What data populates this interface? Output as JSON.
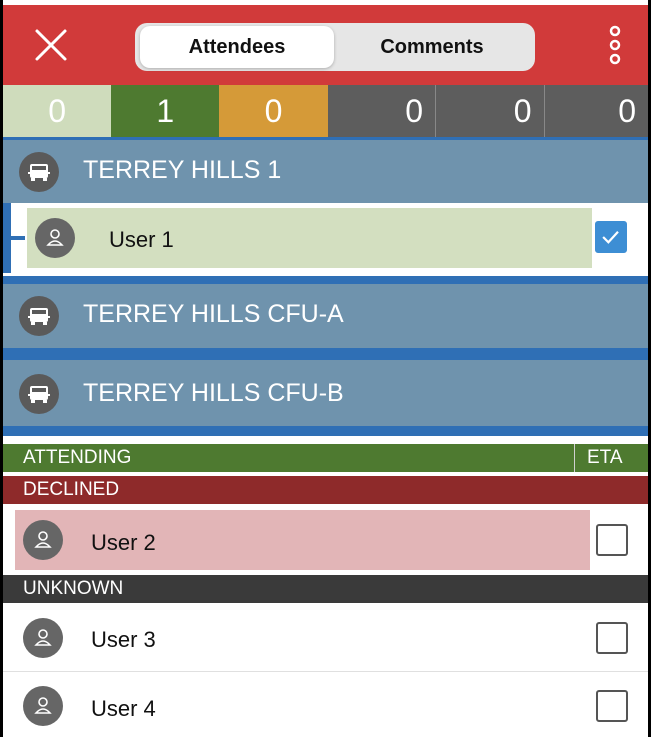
{
  "tabs": {
    "attendees": "Attendees",
    "comments": "Comments"
  },
  "counts": [
    "0",
    "1",
    "0",
    "0",
    "0",
    "0"
  ],
  "groups": [
    {
      "name": "TERREY HILLS 1"
    },
    {
      "name": "TERREY HILLS CFU-A"
    },
    {
      "name": "TERREY HILLS CFU-B"
    }
  ],
  "group_users": [
    {
      "name": "User 1",
      "checked": true
    }
  ],
  "sections": {
    "attending": "ATTENDING",
    "eta": "ETA",
    "declined": "DECLINED",
    "unknown": "UNKNOWN"
  },
  "declined_users": [
    {
      "name": "User 2"
    }
  ],
  "unknown_users": [
    {
      "name": "User 3"
    },
    {
      "name": "User 4"
    }
  ],
  "colors": {
    "header": "#d13a3a",
    "group": "#6f93ad",
    "attending": "#4e7a30",
    "declined": "#8e2a2a",
    "unknown": "#3a3a3a",
    "checked": "#3d8ed4"
  }
}
